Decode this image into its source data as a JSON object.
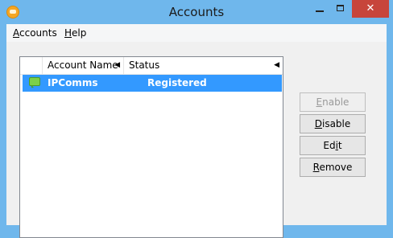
{
  "window": {
    "title": "Accounts"
  },
  "menu": {
    "items": [
      {
        "mnemonic": "A",
        "rest": "ccounts"
      },
      {
        "mnemonic": "H",
        "rest": "elp"
      }
    ]
  },
  "list": {
    "columns": [
      "Account Name",
      "Status"
    ],
    "rows": [
      {
        "name": "IPComms",
        "status": "Registered",
        "selected": true
      }
    ]
  },
  "buttons": {
    "enable": {
      "mnemonic": "E",
      "rest": "nable",
      "enabled": false
    },
    "disable": {
      "mnemonic": "D",
      "rest": "isable",
      "enabled": true
    },
    "edit": {
      "pre": "Ed",
      "mnemonic": "i",
      "rest": "t",
      "enabled": true
    },
    "remove": {
      "mnemonic": "R",
      "rest": "emove",
      "enabled": true
    }
  },
  "colors": {
    "selection": "#3399ff",
    "title_bar": "#6fb7ec",
    "close_button": "#c7453b",
    "account_icon": "#7cd04a"
  },
  "icons": {
    "app": "orange-app-icon",
    "account": "green-chat-bubble-icon"
  }
}
